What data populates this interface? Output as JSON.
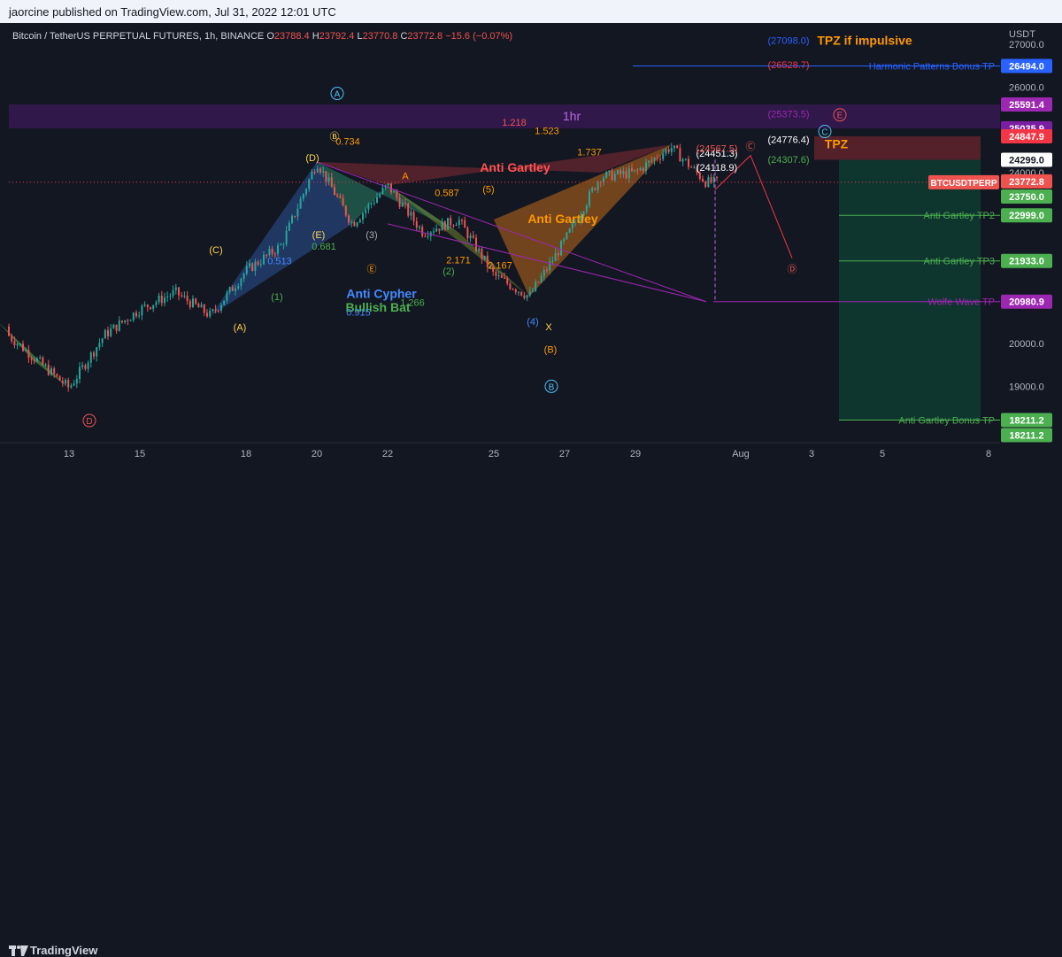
{
  "header": {
    "publisher": "jaorcine published on TradingView.com, Jul 31, 2022 12:01 UTC"
  },
  "footer": {
    "brand": "TradingView"
  },
  "legend": {
    "symbol": "Bitcoin / TetherUS PERPETUAL FUTURES, 1h, BINANCE",
    "o_label": "O",
    "o": "23788.4",
    "h_label": "H",
    "h": "23792.4",
    "l_label": "L",
    "l": "23770.8",
    "c_label": "C",
    "c": "23772.8",
    "change": "−15.6 (−0.07%)"
  },
  "currency": "USDT",
  "colors": {
    "bg": "#131722",
    "up": "#26a69a",
    "down": "#ef5350",
    "grid": "#1e222d",
    "purple": "#9c27b0",
    "orange": "#ff9800",
    "green": "#4caf50",
    "blue": "#2962ff",
    "red": "#f23645"
  },
  "chart_data": {
    "type": "line",
    "title": "Bitcoin / TetherUS PERPETUAL FUTURES, 1h, BINANCE",
    "xlabel": "",
    "ylabel": "",
    "xlim": [
      "2022-07-11",
      "2022-08-08"
    ],
    "ylim": [
      18000,
      27400
    ],
    "x_ticks": [
      "13",
      "15",
      "18",
      "20",
      "22",
      "25",
      "27",
      "29",
      "Aug",
      "3",
      "5",
      "8"
    ],
    "y_ticks": [
      "27000.0",
      "26000.0",
      "25000.0",
      "24000.0",
      "23000.0",
      "22000.0",
      "21000.0",
      "20000.0",
      "19000.0"
    ],
    "grid": false,
    "series": [
      {
        "values": [
          {
            "x": "2022-07-11",
            "y": 20400
          },
          {
            "x": "2022-07-13",
            "y": 18960
          },
          {
            "x": "2022-07-14",
            "y": 20200
          },
          {
            "x": "2022-07-15",
            "y": 20800
          },
          {
            "x": "2022-07-16",
            "y": 21200
          },
          {
            "x": "2022-07-17",
            "y": 20650
          },
          {
            "x": "2022-07-18",
            "y": 21700
          },
          {
            "x": "2022-07-19",
            "y": 22300
          },
          {
            "x": "2022-07-20",
            "y": 24250
          },
          {
            "x": "2022-07-21",
            "y": 22800
          },
          {
            "x": "2022-07-22",
            "y": 23700
          },
          {
            "x": "2022-07-23",
            "y": 22600
          },
          {
            "x": "2022-07-24",
            "y": 22900
          },
          {
            "x": "2022-07-25",
            "y": 21600
          },
          {
            "x": "2022-07-26",
            "y": 21100
          },
          {
            "x": "2022-07-27",
            "y": 22400
          },
          {
            "x": "2022-07-28",
            "y": 23900
          },
          {
            "x": "2022-07-29",
            "y": 24000
          },
          {
            "x": "2022-07-30",
            "y": 24600
          },
          {
            "x": "2022-07-31",
            "y": 23772.8
          }
        ]
      }
    ],
    "price_lines": [
      {
        "label": "Harmonic Patterns Bonus TP",
        "value": 26494.0,
        "color": "#2962ff"
      },
      {
        "label": "Anti Gartley TP2",
        "value": 22999.0,
        "color": "#4caf50"
      },
      {
        "label": "Anti Gartley TP3",
        "value": 21933.0,
        "color": "#4caf50"
      },
      {
        "label": "Wolfe Wave TP",
        "value": 20980.9,
        "color": "#9c27b0"
      },
      {
        "label": "Anti Gartley Bonus TP",
        "value": 18211.2,
        "color": "#4caf50"
      }
    ],
    "price_badges": [
      {
        "text": "26494.0",
        "value": 26494.0,
        "color": "#2962ff"
      },
      {
        "text": "25591.4",
        "value": 25591.4,
        "color": "#9c27b0"
      },
      {
        "text": "25035.9",
        "value": 25035.9,
        "color": "#7b1fa2"
      },
      {
        "text": "24847.9",
        "value": 24847.9,
        "color": "#f23645"
      },
      {
        "text": "24299.0",
        "value": 24299.0,
        "color": "#ffffff"
      },
      {
        "text": "23772.8",
        "value": 23772.8,
        "color": "#ef5350"
      },
      {
        "text": "23750.0",
        "value": 23750.0,
        "color": "#4caf50"
      },
      {
        "text": "22999.0",
        "value": 22999.0,
        "color": "#4caf50"
      },
      {
        "text": "21933.0",
        "value": 21933.0,
        "color": "#4caf50"
      },
      {
        "text": "20980.9",
        "value": 20980.9,
        "color": "#9c27b0"
      },
      {
        "text": "18211.2",
        "value": 18211.2,
        "color": "#4caf50"
      },
      {
        "text": "18211.2",
        "value": 18211.2,
        "color": "#4caf50"
      }
    ],
    "symbol_badge": "BTCUSDTPERP",
    "fib_levels": [
      "(27098.0)",
      "(26528.7)",
      "(25373.5)",
      "(24776.4)",
      "(24451.3)",
      "(24307.6)",
      "(24118.9)",
      "(24567.5)"
    ],
    "annotations": [
      "TPZ if impulsive",
      "TPZ",
      "1hr",
      "Anti Gartley",
      "Anti Gartley",
      "Anti Cypher",
      "Bullish Bat",
      "1.218",
      "1.523",
      "1.737",
      "0.734",
      "0.587",
      "0.681",
      "0.513",
      "0.915",
      "1.266",
      "2.167",
      "2.171",
      "Ⓐ",
      "Ⓑ",
      "Ⓒ",
      "Ⓓ",
      "Ⓔ",
      "(5)",
      "(B)",
      "(C)",
      "(A)",
      "(D)",
      "(E)",
      "(1)",
      "(2)",
      "(3)",
      "(4)",
      "X",
      "A",
      "B",
      "C",
      "D",
      "K"
    ]
  }
}
